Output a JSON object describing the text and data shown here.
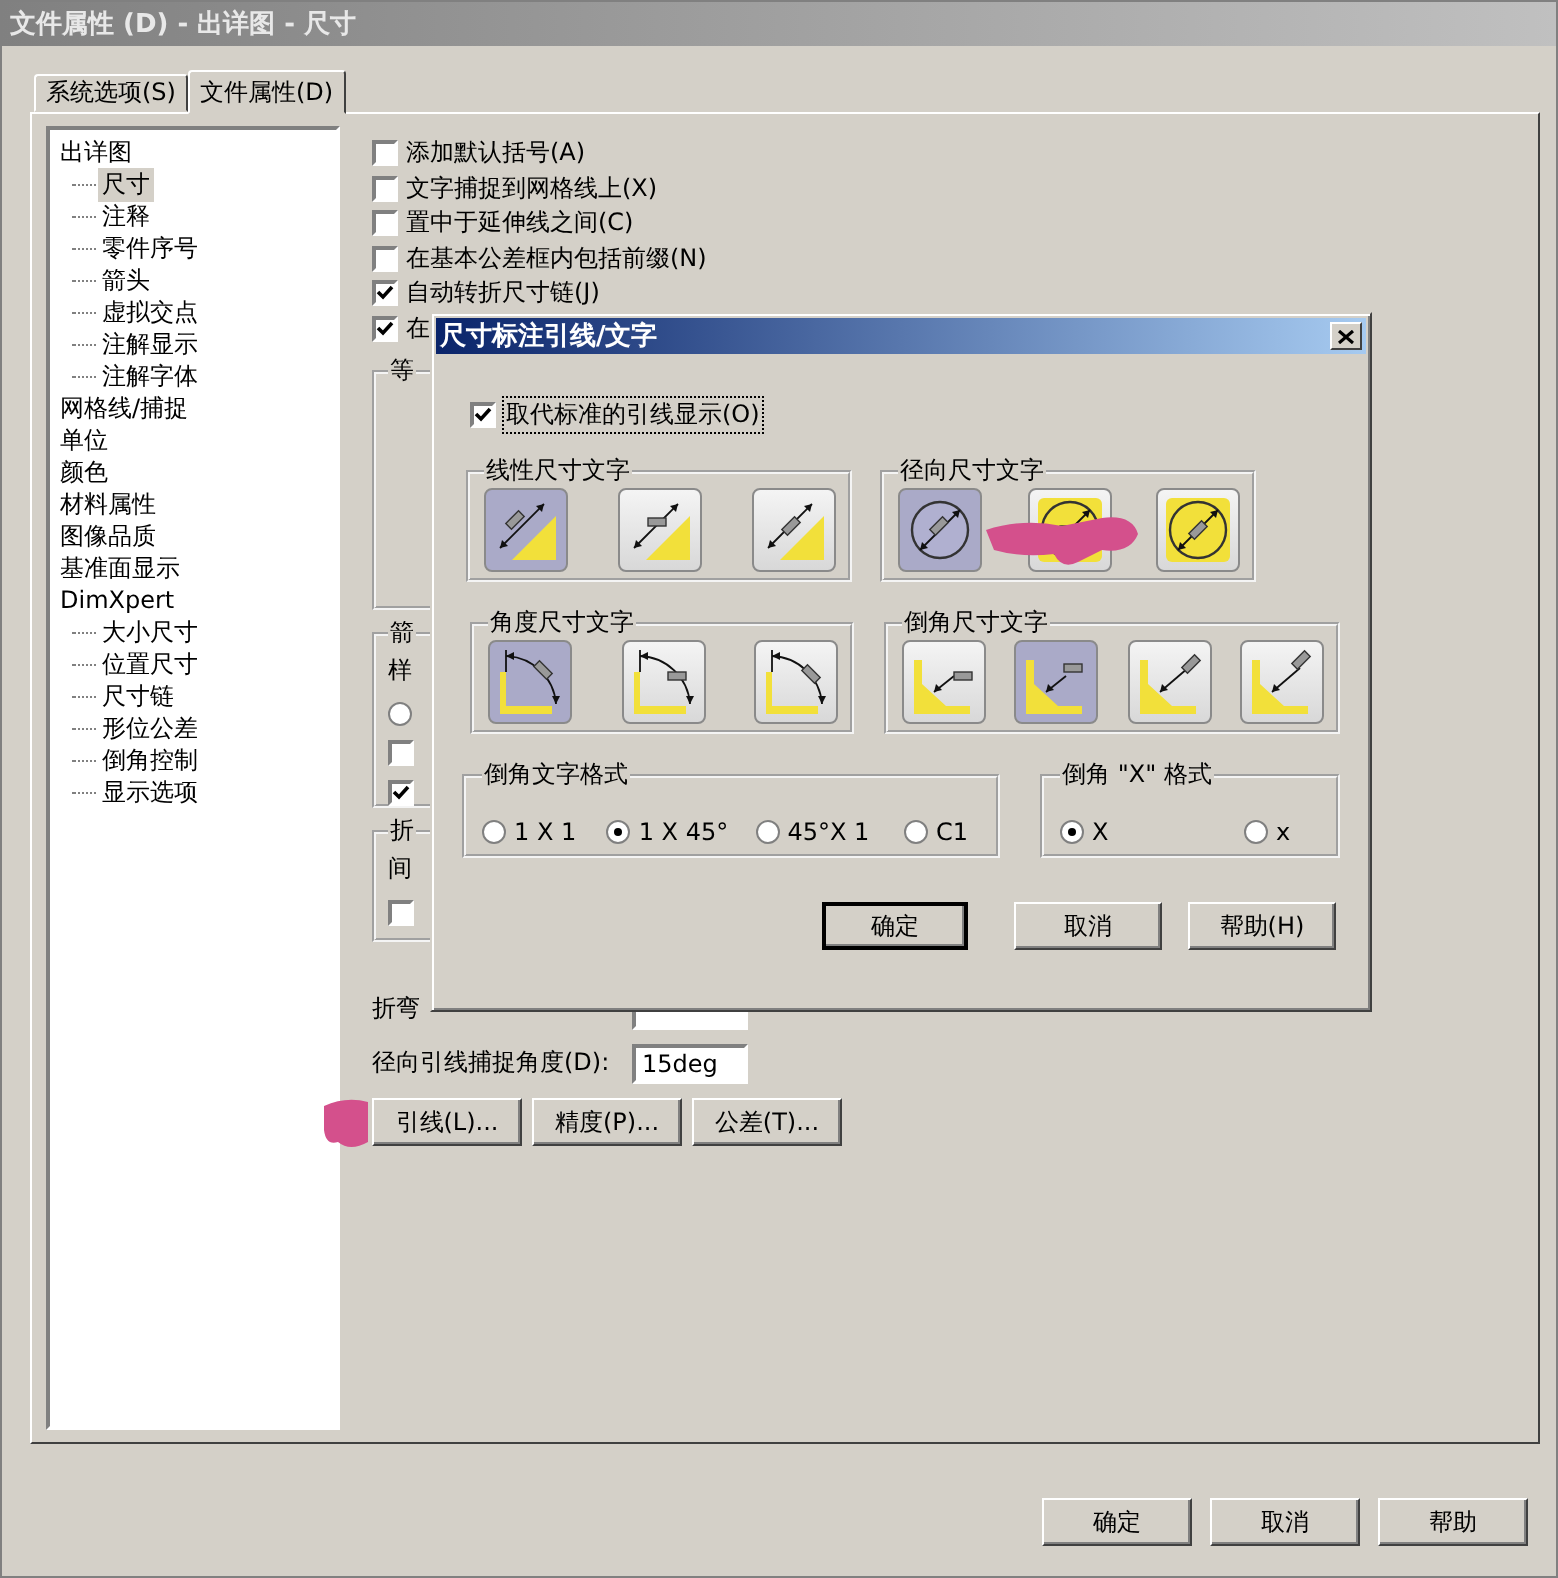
{
  "window": {
    "title": "文件属性 (D) - 出详图 - 尺寸"
  },
  "tabs": [
    {
      "label": "系统选项(S)",
      "selected": false
    },
    {
      "label": "文件属性(D)",
      "selected": true
    }
  ],
  "tree": [
    {
      "label": "出详图",
      "selected": false,
      "children": [
        {
          "label": "尺寸",
          "selected": true
        },
        {
          "label": "注释",
          "selected": false
        },
        {
          "label": "零件序号",
          "selected": false
        },
        {
          "label": "箭头",
          "selected": false
        },
        {
          "label": "虚拟交点",
          "selected": false
        },
        {
          "label": "注解显示",
          "selected": false
        },
        {
          "label": "注解字体",
          "selected": false
        }
      ]
    },
    {
      "label": "网格线/捕捉",
      "selected": false
    },
    {
      "label": "单位",
      "selected": false
    },
    {
      "label": "颜色",
      "selected": false
    },
    {
      "label": "材料属性",
      "selected": false
    },
    {
      "label": "图像品质",
      "selected": false
    },
    {
      "label": "基准面显示",
      "selected": false
    },
    {
      "label": "DimXpert",
      "selected": false,
      "children": [
        {
          "label": "大小尺寸",
          "selected": false
        },
        {
          "label": "位置尺寸",
          "selected": false
        },
        {
          "label": "尺寸链",
          "selected": false
        },
        {
          "label": "形位公差",
          "selected": false
        },
        {
          "label": "倒角控制",
          "selected": false
        },
        {
          "label": "显示选项",
          "selected": false
        }
      ]
    }
  ],
  "options": {
    "checkboxes": [
      {
        "label": "添加默认括号(A)",
        "checked": false
      },
      {
        "label": "文字捕捉到网格线上(X)",
        "checked": false
      },
      {
        "label": "置中于延伸线之间(C)",
        "checked": false
      },
      {
        "label": "在基本公差框内包括前缀(N)",
        "checked": false
      },
      {
        "label": "自动转折尺寸链(J)",
        "checked": true
      },
      {
        "label": "在",
        "checked": true
      }
    ],
    "groups": [
      {
        "title": "等"
      },
      {
        "title": "箭",
        "items": [
          {
            "kind": "label",
            "label": "样"
          },
          {
            "kind": "radio",
            "selected": false
          },
          {
            "kind": "checkbox",
            "checked": false
          },
          {
            "kind": "checkbox",
            "checked": true
          }
        ]
      },
      {
        "title": "折",
        "items": [
          {
            "kind": "label",
            "label": "间"
          },
          {
            "kind": "checkbox",
            "checked": false
          }
        ]
      }
    ],
    "fields": [
      {
        "label": "折弯"
      },
      {
        "label": "径向引线捕捉角度(D):",
        "value": "15deg"
      }
    ],
    "buttons": [
      "引线(L)...",
      "精度(P)...",
      "公差(T)..."
    ]
  },
  "footer_buttons": [
    "确定",
    "取消",
    "帮助"
  ],
  "dialog": {
    "title": "尺寸标注引线/文字",
    "override": {
      "label": "取代标准的引线显示(O)",
      "checked": true
    },
    "style_rows": [
      [
        {
          "title": "线性尺寸文字",
          "kind": "linear",
          "options": [
            {
              "selected": true
            },
            {
              "selected": false
            },
            {
              "selected": false
            }
          ]
        },
        {
          "title": "径向尺寸文字",
          "kind": "radial",
          "options": [
            {
              "selected": true
            },
            {
              "selected": false
            },
            {
              "selected": false
            }
          ]
        }
      ],
      [
        {
          "title": "角度尺寸文字",
          "kind": "angle",
          "options": [
            {
              "selected": true
            },
            {
              "selected": false
            },
            {
              "selected": false
            }
          ]
        },
        {
          "title": "倒角尺寸文字",
          "kind": "chamfer",
          "options": [
            {
              "selected": false
            },
            {
              "selected": true
            },
            {
              "selected": false
            },
            {
              "selected": false
            }
          ]
        }
      ]
    ],
    "format_groups": [
      {
        "title": "倒角文字格式",
        "options": [
          {
            "label": "1 X 1",
            "selected": false
          },
          {
            "label": "1 X 45°",
            "selected": true
          },
          {
            "label": "45°X 1",
            "selected": false
          },
          {
            "label": "C1",
            "selected": false
          }
        ]
      },
      {
        "title": "倒角 \"X\" 格式",
        "options": [
          {
            "label": "X",
            "selected": true
          },
          {
            "label": "x",
            "selected": false
          }
        ]
      }
    ],
    "buttons": [
      {
        "label": "确定",
        "default": true
      },
      {
        "label": "取消",
        "default": false
      },
      {
        "label": "帮助(H)",
        "default": false
      }
    ]
  }
}
